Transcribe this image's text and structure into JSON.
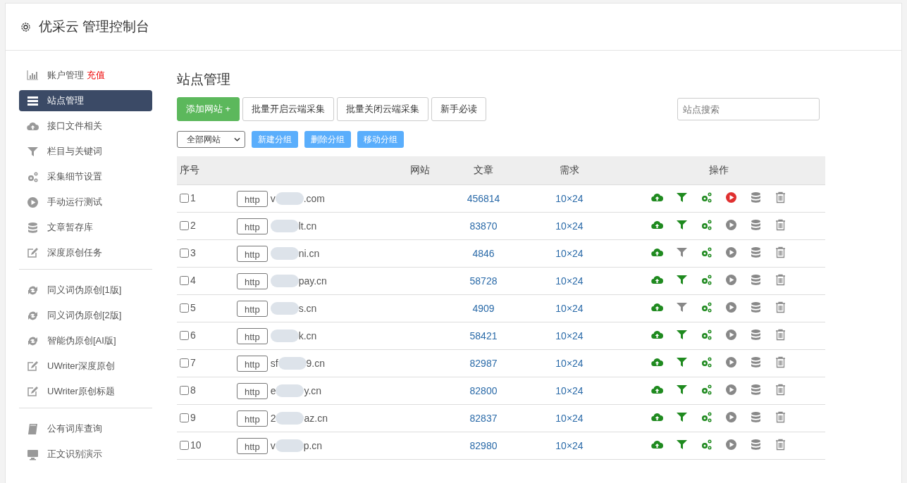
{
  "header": {
    "title": "优采云 管理控制台"
  },
  "sidebar": {
    "groups": [
      {
        "items": [
          {
            "label": "账户管理",
            "badge": "充值",
            "kind": "chart",
            "selected": false
          },
          {
            "label": "站点管理",
            "kind": "server",
            "selected": true
          },
          {
            "label": "接口文件相关",
            "kind": "cloud",
            "selected": false
          },
          {
            "label": "栏目与关键词",
            "kind": "filter",
            "selected": false
          },
          {
            "label": "采集细节设置",
            "kind": "gears",
            "selected": false
          },
          {
            "label": "手动运行测试",
            "kind": "play",
            "selected": false
          },
          {
            "label": "文章暂存库",
            "kind": "database",
            "selected": false
          },
          {
            "label": "深度原创任务",
            "kind": "edit",
            "selected": false
          }
        ]
      },
      {
        "items": [
          {
            "label": "同义词伪原创[1版]",
            "kind": "refresh",
            "selected": false
          },
          {
            "label": "同义词伪原创[2版]",
            "kind": "refresh",
            "selected": false
          },
          {
            "label": "智能伪原创[AI版]",
            "kind": "refresh",
            "selected": false
          },
          {
            "label": "UWriter深度原创",
            "kind": "edit",
            "selected": false
          },
          {
            "label": "UWriter原创标题",
            "kind": "edit",
            "selected": false
          }
        ]
      },
      {
        "items": [
          {
            "label": "公有词库查询",
            "kind": "book",
            "selected": false
          },
          {
            "label": "正文识别演示",
            "kind": "monitor",
            "selected": false
          }
        ]
      }
    ]
  },
  "main": {
    "title": "站点管理",
    "toolbar": [
      {
        "label": "添加网站 +",
        "kind": "primary"
      },
      {
        "label": "批量开启云端采集",
        "kind": "default"
      },
      {
        "label": "批量关闭云端采集",
        "kind": "default"
      },
      {
        "label": "新手必读",
        "kind": "default"
      }
    ],
    "search": {
      "placeholder": "站点搜索"
    },
    "group_select": {
      "value": "全部网站"
    },
    "group_buttons": [
      "新建分组",
      "删除分组",
      "移动分组"
    ],
    "table": {
      "columns": [
        "序号",
        "网站",
        "文章",
        "需求",
        "操作"
      ],
      "rows": [
        {
          "checked": false,
          "index": "1",
          "protocol": "http",
          "site_head": "v",
          "site_tail": ".com",
          "articles": "456814",
          "demand": "10×24",
          "filter_on": true,
          "running": true
        },
        {
          "checked": false,
          "index": "2",
          "protocol": "http",
          "site_head": "",
          "site_tail": "lt.cn",
          "articles": "83870",
          "demand": "10×24",
          "filter_on": true,
          "running": false
        },
        {
          "checked": false,
          "index": "3",
          "protocol": "http",
          "site_head": "",
          "site_tail": "ni.cn",
          "articles": "4846",
          "demand": "10×24",
          "filter_on": false,
          "running": false
        },
        {
          "checked": false,
          "index": "4",
          "protocol": "http",
          "site_head": "",
          "site_tail": "pay.cn",
          "articles": "58728",
          "demand": "10×24",
          "filter_on": true,
          "running": false
        },
        {
          "checked": false,
          "index": "5",
          "protocol": "http",
          "site_head": "",
          "site_tail": "s.cn",
          "articles": "4909",
          "demand": "10×24",
          "filter_on": false,
          "running": false
        },
        {
          "checked": false,
          "index": "6",
          "protocol": "http",
          "site_head": "",
          "site_tail": "k.cn",
          "articles": "58421",
          "demand": "10×24",
          "filter_on": true,
          "running": false
        },
        {
          "checked": false,
          "index": "7",
          "protocol": "http",
          "site_head": "sf",
          "site_tail": "9.cn",
          "articles": "82987",
          "demand": "10×24",
          "filter_on": true,
          "running": false
        },
        {
          "checked": false,
          "index": "8",
          "protocol": "http",
          "site_head": "e",
          "site_tail": "y.cn",
          "articles": "82800",
          "demand": "10×24",
          "filter_on": true,
          "running": false
        },
        {
          "checked": false,
          "index": "9",
          "protocol": "http",
          "site_head": "2",
          "site_tail": "az.cn",
          "articles": "82837",
          "demand": "10×24",
          "filter_on": true,
          "running": false
        },
        {
          "checked": false,
          "index": "10",
          "protocol": "http",
          "site_head": "v",
          "site_tail": "p.cn",
          "articles": "82980",
          "demand": "10×24",
          "filter_on": true,
          "running": false
        }
      ]
    }
  }
}
